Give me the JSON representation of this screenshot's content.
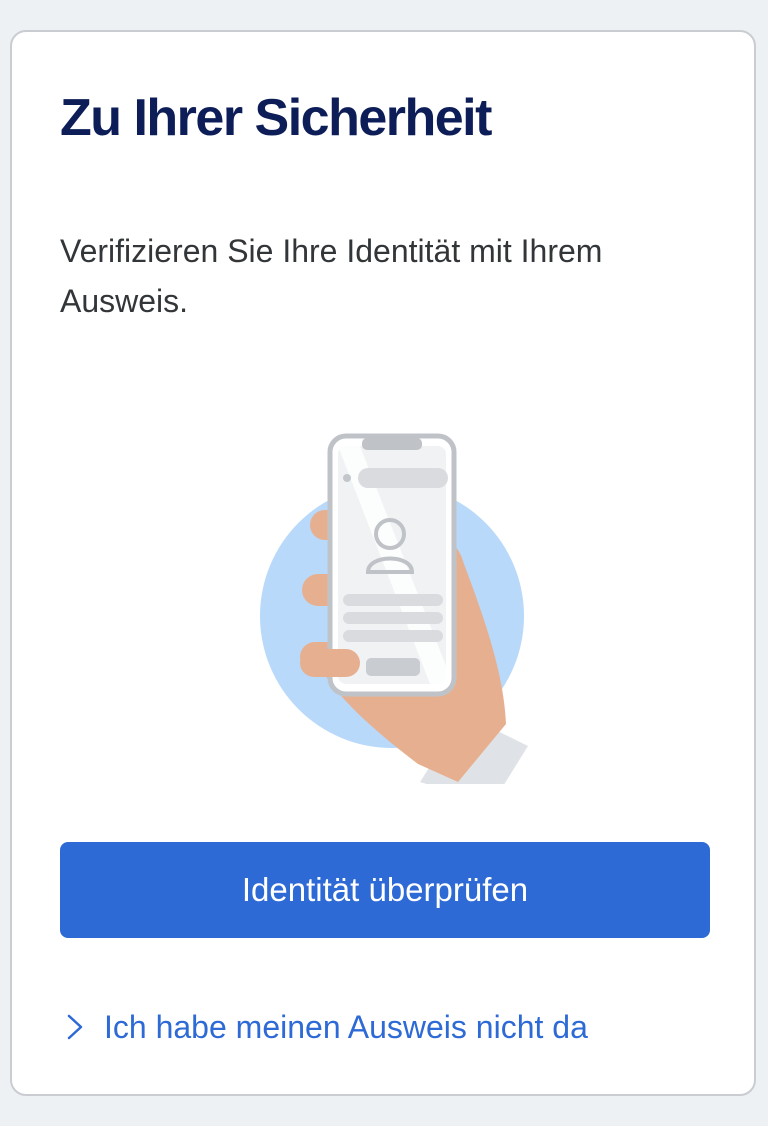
{
  "page": {
    "title": "Zu Ihrer Sicherheit",
    "description": "Verifizieren Sie Ihre Identität mit Ihrem Ausweis.",
    "illustration_icon": "phone-id-verification-illustration",
    "primary_button_label": "Identität überprüfen",
    "secondary_link_label": "Ich habe meinen Ausweis nicht da",
    "secondary_link_icon": "chevron-right-icon"
  },
  "colors": {
    "title": "#0c1d57",
    "primary": "#2e6ad6",
    "page_background": "#eef1f4",
    "card_border": "#c9ccd1",
    "illustration_circle": "#b8d9fa",
    "skin": "#e6b090"
  }
}
